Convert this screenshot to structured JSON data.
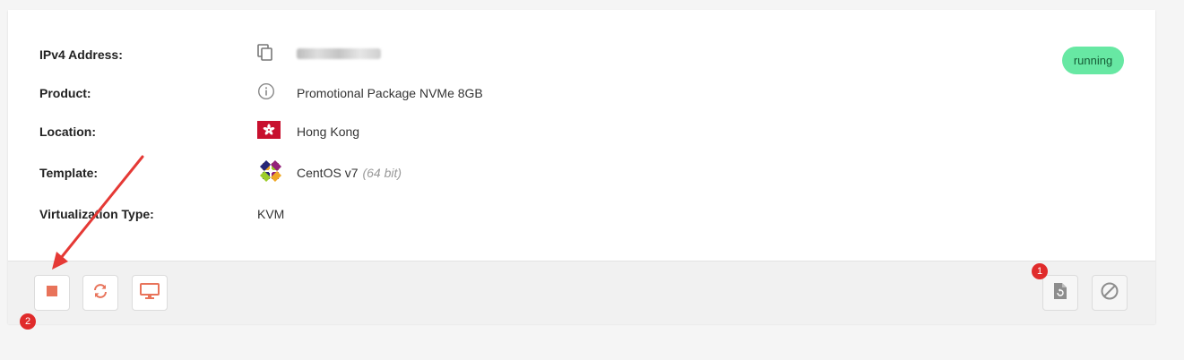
{
  "status": {
    "label": "running",
    "color": "#67e8a3"
  },
  "details": {
    "ipv4": {
      "label": "IPv4 Address:",
      "icon": "copy-icon"
    },
    "product": {
      "label": "Product:",
      "value": "Promotional Package NVMe 8GB",
      "icon": "info-icon"
    },
    "location": {
      "label": "Location:",
      "value": "Hong Kong",
      "icon": "hong-kong-flag-icon"
    },
    "template": {
      "label": "Template:",
      "value": "CentOS v7",
      "note": "(64 bit)",
      "icon": "centos-logo-icon"
    },
    "virtualization": {
      "label": "Virtualization Type:",
      "value": "KVM"
    }
  },
  "actions": {
    "left": [
      {
        "name": "stop",
        "icon": "stop-icon"
      },
      {
        "name": "restart",
        "icon": "refresh-icon"
      },
      {
        "name": "console",
        "icon": "monitor-icon"
      }
    ],
    "right": [
      {
        "name": "reinstall",
        "icon": "file-restore-icon"
      },
      {
        "name": "disable",
        "icon": "block-icon"
      }
    ]
  },
  "annotations": {
    "badge_1": "1",
    "badge_2": "2"
  },
  "colors": {
    "accent": "#e8735a",
    "badge": "#e02b2b",
    "arrow": "#e53935"
  }
}
